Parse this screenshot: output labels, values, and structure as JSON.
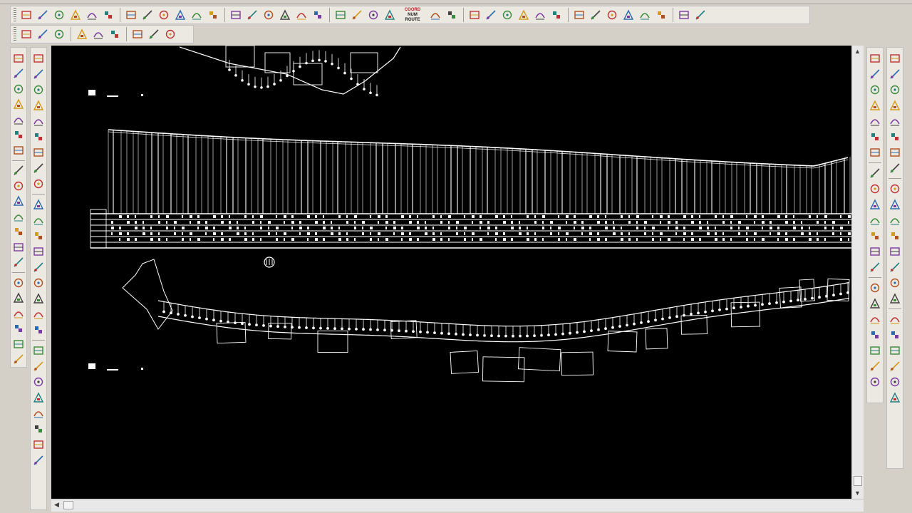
{
  "toolbar_row1_icons": [
    "layer-manager-icon",
    "edit-layer-icon",
    "elevation-icon",
    "elevation-label-icon",
    "point-list-icon",
    "grid-icon",
    "survey-icon",
    "insert-point-icon",
    "snap-icon",
    "node-icon",
    "lightbulb-icon",
    "block-icon",
    "symbol-icon",
    "property-icon",
    "cube-icon",
    "window-icon",
    "curve-icon",
    "slope-icon",
    "contour-icon",
    "tin-icon",
    "section-icon",
    "profile-icon",
    "cross-icon",
    "coordinate-icon",
    "number-route-icon",
    "angle-icon",
    "triangle-icon",
    "hatch-row-icon",
    "dotted-row-icon",
    "table-row-icon",
    "table-grid-icon",
    "chart-icon",
    "edit-pen-icon",
    "eraser-icon",
    "hatch-icon",
    "fill-icon",
    "color-icon",
    "paint-icon"
  ],
  "toolbar_row1_text": {
    "coord_button": "COORD",
    "num_button": "NUM",
    "route_button": "ROUTE"
  },
  "toolbar_row2_icons": [
    "open-grid-icon",
    "table-icon",
    "arrow-up-icon",
    "matrix-icon",
    "transform-icon",
    "text-style-icon",
    "copy-text-icon",
    "zoom-window-icon",
    "pattern-icon"
  ],
  "left_tools_col1": [
    "line-icon",
    "polyline-icon",
    "arc-icon",
    "polygon-icon",
    "rectangle-icon",
    "arc-2-icon",
    "circle-icon",
    "revcloud-icon",
    "spline-icon",
    "ellipse-icon",
    "ellipse-arc-icon",
    "insert-block-icon",
    "make-block-icon",
    "point-icon",
    "hatch-tool-icon",
    "gradient-icon",
    "region-icon",
    "table-tool-icon",
    "text-icon",
    "add-selected-icon"
  ],
  "left_tools_col2": [
    "eraser-tool-icon",
    "copy-icon",
    "mirror-icon",
    "offset-icon",
    "array-icon",
    "move-icon",
    "rotate-icon",
    "scale-icon",
    "stretch-icon",
    "trim-icon",
    "extend-icon",
    "break-icon",
    "join-icon",
    "chamfer-icon",
    "fillet-icon",
    "explode-icon",
    "blend-icon",
    "box-3d-icon",
    "cylinder-3d-icon",
    "sphere-3d-icon",
    "cone-3d-icon",
    "wedge-3d-icon",
    "torus-3d-icon",
    "render-icon",
    "material-icon",
    "light-icon"
  ],
  "right_tools_col1": [
    "dim-linear-icon",
    "dim-aligned-icon",
    "dim-arc-icon",
    "dim-ordinate-icon",
    "dim-radius-icon",
    "dim-jogged-icon",
    "dim-diameter-icon",
    "dim-angular-icon",
    "quick-dim-icon",
    "dim-baseline-icon",
    "dim-continue-icon",
    "dim-space-icon",
    "dim-break-icon",
    "tolerance-icon",
    "center-mark-icon",
    "inspect-icon",
    "jogged-linear-icon",
    "dim-edit-icon",
    "dim-text-edit-icon",
    "dim-update-icon",
    "dim-style-icon"
  ],
  "right_tools_col2": [
    "snap-endpoint-icon",
    "snap-midpoint-icon",
    "snap-intersect-icon",
    "snap-apparent-icon",
    "snap-extension-icon",
    "snap-center-icon",
    "snap-quadrant-icon",
    "snap-tangent-icon",
    "snap-perpendicular-icon",
    "snap-parallel-icon",
    "snap-insert-icon",
    "snap-node-icon",
    "snap-nearest-icon",
    "snap-none-icon",
    "snap-settings-icon",
    "magnet-icon",
    "layer-copy-icon",
    "layer-isolate-icon",
    "layer-off-icon",
    "layer-freeze-icon",
    "layer-lock-icon",
    "layer-walk-icon"
  ],
  "drawing": {
    "label_top": "",
    "label_bottom": ""
  }
}
